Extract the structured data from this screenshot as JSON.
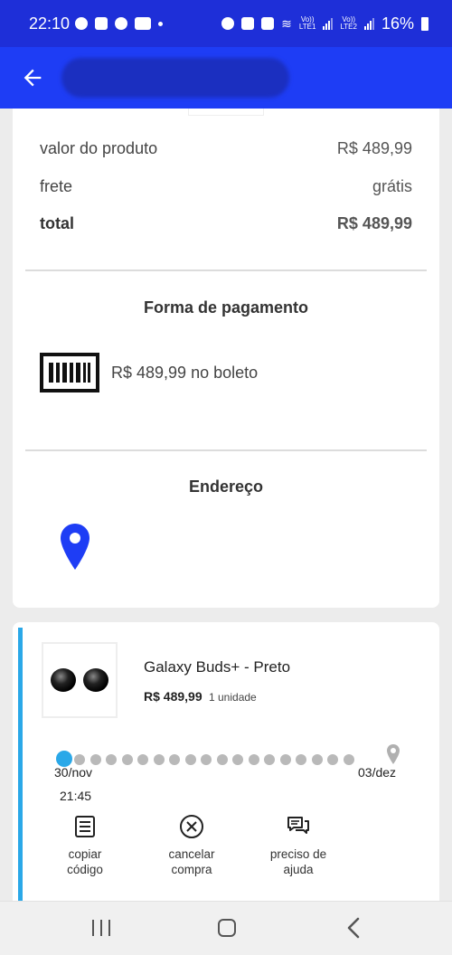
{
  "status_bar": {
    "time": "22:10",
    "battery": "16%",
    "lte1": "LTE1",
    "lte2": "LTE2",
    "volte": "Vo))"
  },
  "summary": {
    "product_label": "valor do produto",
    "product_value": "R$ 489,99",
    "shipping_label": "frete",
    "shipping_value": "grátis",
    "total_label": "total",
    "total_value": "R$ 489,99"
  },
  "payment": {
    "title": "Forma de pagamento",
    "text": "R$ 489,99 no boleto"
  },
  "address": {
    "title": "Endereço"
  },
  "order": {
    "product_name": "Galaxy Buds+ - Preto",
    "price": "R$ 489,99",
    "quantity": "1 unidade",
    "start_date": "30/nov",
    "start_time": "21:45",
    "end_date": "03/dez",
    "progress_steps_total": 19,
    "progress_steps_done": 1
  },
  "actions": [
    {
      "label_1": "copiar",
      "label_2": "código",
      "icon": "list-icon"
    },
    {
      "label_1": "cancelar",
      "label_2": "compra",
      "icon": "cancel-circle-icon"
    },
    {
      "label_1": "preciso de",
      "label_2": "ajuda",
      "icon": "chat-icon"
    }
  ],
  "colors": {
    "status_bar": "#1e2fd8",
    "app_bar": "#1e3df5",
    "accent": "#2aa8e8",
    "pin": "#1e3df5"
  }
}
